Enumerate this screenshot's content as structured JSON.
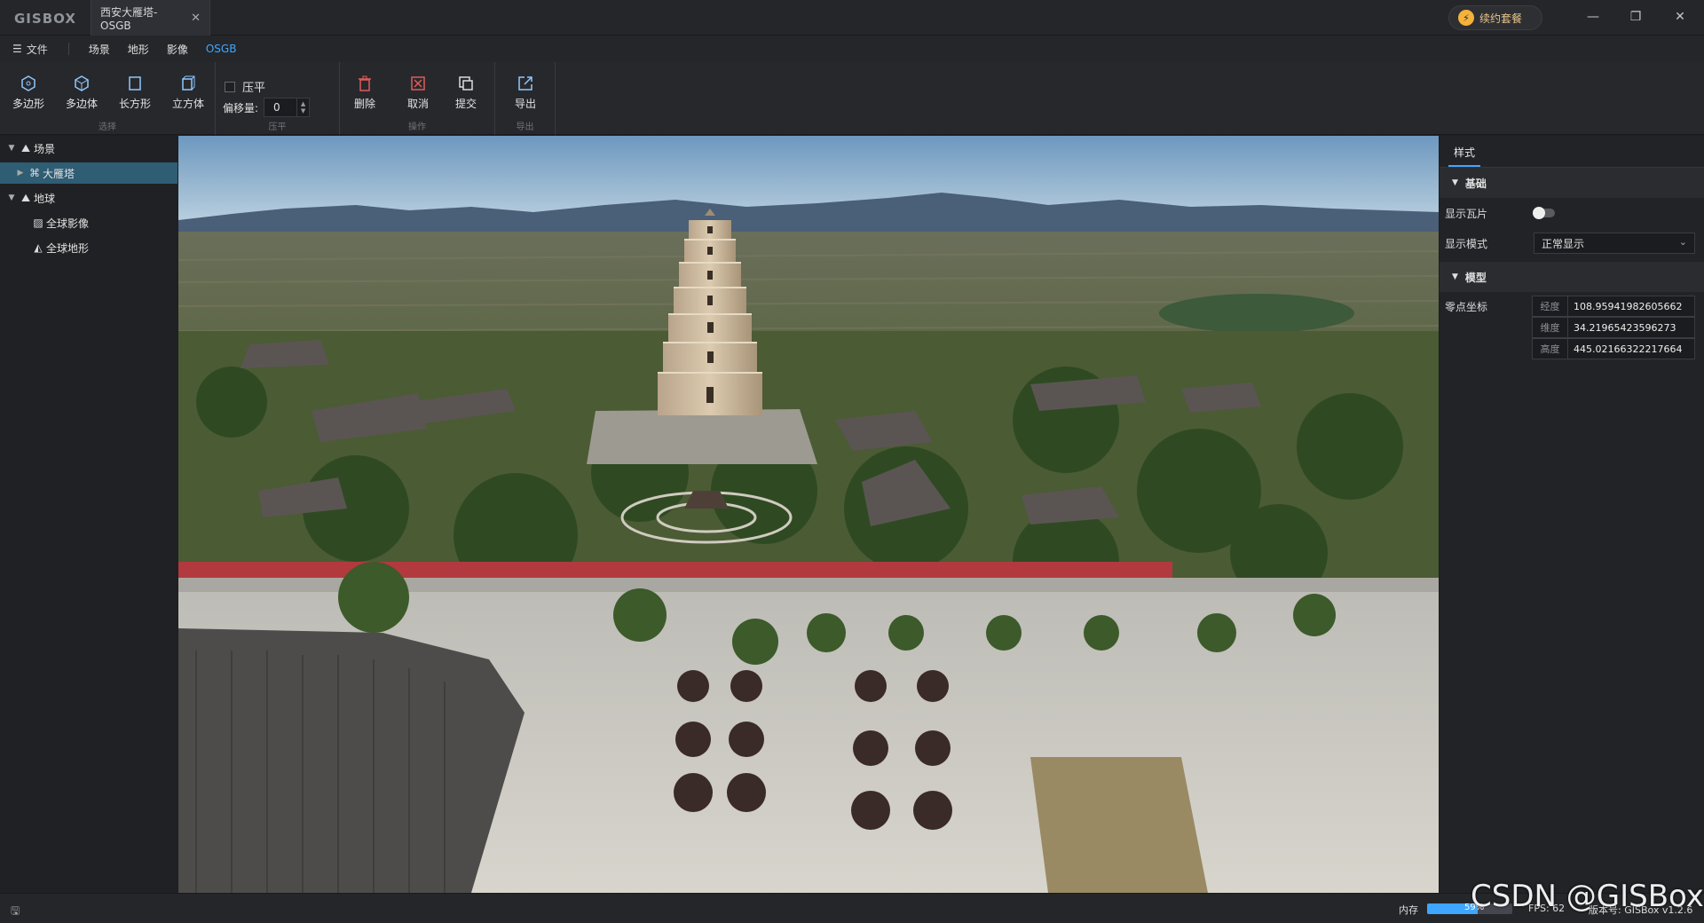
{
  "app": {
    "logo": "GISBOX",
    "tab_title": "西安大雁塔-OSGB",
    "renew_label": "续约套餐"
  },
  "menu": {
    "file": "文件",
    "items": [
      "场景",
      "地形",
      "影像",
      "OSGB"
    ],
    "active": "OSGB"
  },
  "ribbon": {
    "select_group": "选择",
    "select_buttons": [
      "多边形",
      "多边体",
      "长方形",
      "立方体"
    ],
    "flatten_group": "压平",
    "flatten_checkbox": "压平",
    "offset_label": "偏移量:",
    "offset_value": "0",
    "ops_group": "操作",
    "ops_buttons": [
      "删除",
      "取消",
      "提交"
    ],
    "export_group": "导出",
    "export_button": "导出"
  },
  "tree": {
    "scene": "场景",
    "dayanta": "大雁塔",
    "earth": "地球",
    "imagery": "全球影像",
    "terrain": "全球地形"
  },
  "panel": {
    "tab": "样式",
    "basic": "基础",
    "show_tiles": "显示瓦片",
    "show_tiles_on": false,
    "display_mode_label": "显示模式",
    "display_mode": "正常显示",
    "model": "模型",
    "origin_label": "零点坐标",
    "lon_label": "经度",
    "lon": "108.95941982605662",
    "lat_label": "维度",
    "lat": "34.21965423596273",
    "alt_label": "高度",
    "alt": "445.02166322217664"
  },
  "status": {
    "mem_label": "内存",
    "mem_percent": 59,
    "mem_text": "59%",
    "fps": "FPS: 62",
    "version": "版本号: GISBox v1.2.6"
  },
  "watermark": "CSDN @GISBox",
  "colors": {
    "accent": "#3fa7ff",
    "selected": "#2e5d74",
    "wall": "#b23a3e"
  }
}
